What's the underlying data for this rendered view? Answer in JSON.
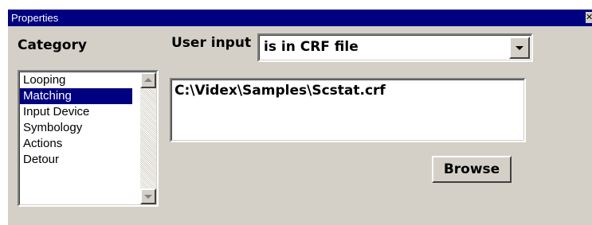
{
  "window": {
    "title": "Properties",
    "close_icon": "close-icon",
    "close_glyph": "✕"
  },
  "category": {
    "label": "Category",
    "items": [
      {
        "label": "Looping",
        "selected": false
      },
      {
        "label": "Matching",
        "selected": true
      },
      {
        "label": "Input Device",
        "selected": false
      },
      {
        "label": "Symbology",
        "selected": false
      },
      {
        "label": "Actions",
        "selected": false
      },
      {
        "label": "Detour",
        "selected": false
      }
    ],
    "scroll_up_icon": "scroll-up-arrow-icon",
    "scroll_down_icon": "scroll-down-arrow-icon"
  },
  "user_input": {
    "label": "User input",
    "selected_option": "is in CRF file",
    "dropdown_icon": "chevron-down-icon"
  },
  "file_path": {
    "value": "C:\\Videx\\Samples\\Scstat.crf"
  },
  "browse_button": {
    "label": "Browse"
  },
  "colors": {
    "title_bar": "#000080",
    "window_face": "#d4d0c8",
    "selection": "#000080"
  }
}
